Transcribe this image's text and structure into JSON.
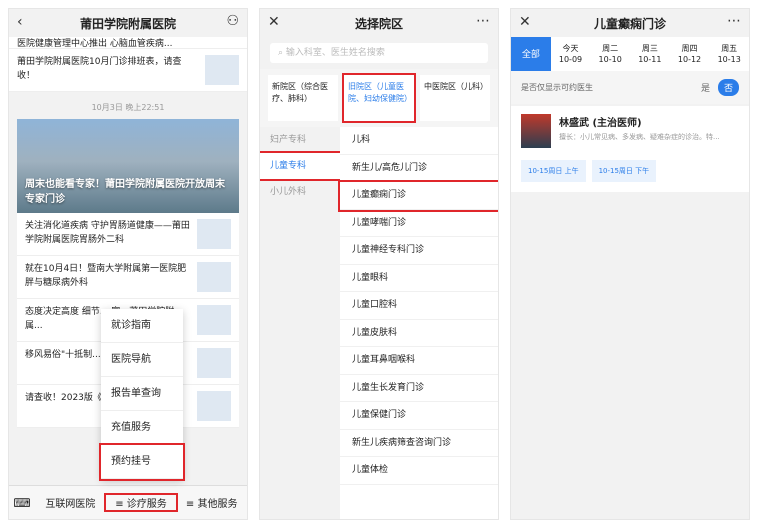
{
  "phone1": {
    "title": "莆田学院附属医院",
    "top_partial": "医院健康管理中心推出 心脑血管疾病...",
    "news_top": "莆田学院附属医院10月门诊排班表，请查收！",
    "timestamp": "10月3日 晚上22:51",
    "hero_title": "周末也能看专家！莆田学院附属医院开放周末专家门诊",
    "news": [
      "关注消化道疾病 守护胃肠道健康——莆田学院附属医院胃肠外二科",
      "就在10月4日！暨南大学附属第一医院肥胖与糖尿病外科",
      "态度决定高度 细节... 家、莆田学院附属...",
      "移风易俗\"十抵制... 要知道!",
      "请查收！2023版《... 传手册》"
    ],
    "menu": [
      "就诊指南",
      "医院导航",
      "报告单查询",
      "充值服务",
      "预约挂号"
    ],
    "tabs": [
      "互联网医院",
      "≡ 诊疗服务",
      "≡ 其他服务"
    ]
  },
  "phone2": {
    "title": "选择院区",
    "search_placeholder": "输入科室、医生姓名搜索",
    "campuses": [
      "新院区（综合医疗、肺科）",
      "旧院区（儿童医院、妇幼保健院）",
      "中医院区（儿科）"
    ],
    "left": [
      "妇产专科",
      "儿童专科",
      "小儿外科"
    ],
    "right": [
      "儿科",
      "新生儿/高危儿门诊",
      "儿童癫痫门诊",
      "儿童哮喘门诊",
      "儿童神经专科门诊",
      "儿童眼科",
      "儿童口腔科",
      "儿童皮肤科",
      "儿童耳鼻咽喉科",
      "儿童生长发育门诊",
      "儿童保健门诊",
      "新生儿疾病筛查咨询门诊",
      "儿童体检"
    ]
  },
  "phone3": {
    "title": "儿童癫痫门诊",
    "days": [
      [
        "全部",
        ""
      ],
      [
        "今天",
        "10-09"
      ],
      [
        "周二",
        "10-10"
      ],
      [
        "周三",
        "10-11"
      ],
      [
        "周四",
        "10-12"
      ],
      [
        "周五",
        "10-13"
      ]
    ],
    "toggle_label": "是否仅显示可约医生",
    "yes": "是",
    "no": "否",
    "doctor_name": "林盛武 (主治医师)",
    "doctor_spec": "擅长：小儿常见病、多发病、疑难杂症的诊治。特...",
    "slots": [
      "10-15周日 上午",
      "10-15周日 下午"
    ]
  }
}
